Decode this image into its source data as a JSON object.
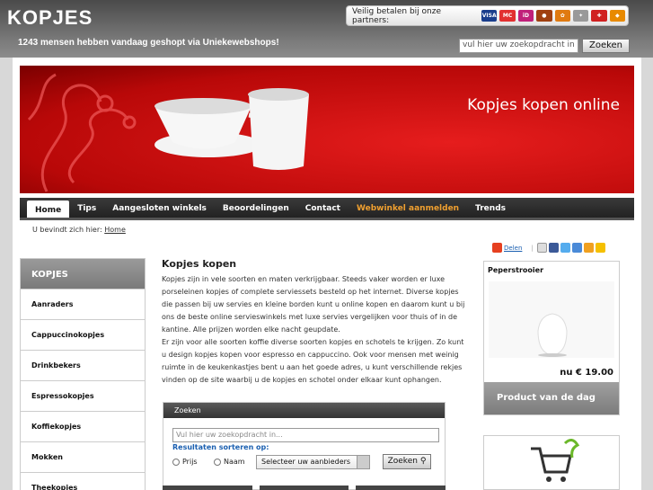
{
  "header": {
    "logo": "KOPJES",
    "tagline": "1243 mensen hebben vandaag geshopt via Uniekewebshops!",
    "partners_label": "Veilig betalen bij onze partners:",
    "partner_icons": [
      "visa-icon",
      "mastercard-icon",
      "ideal-icon",
      "paypal-icon",
      "giropay-icon",
      "ups-icon",
      "dhl-icon",
      "bank-icon"
    ],
    "search_placeholder": "vul hier uw zoekopdracht in",
    "search_button": "Zoeken"
  },
  "banner": {
    "title": "Kopjes kopen online"
  },
  "nav": {
    "items": [
      {
        "label": "Home"
      },
      {
        "label": "Tips"
      },
      {
        "label": "Aangesloten winkels"
      },
      {
        "label": "Beoordelingen"
      },
      {
        "label": "Contact"
      },
      {
        "label": "Webwinkel aanmelden"
      },
      {
        "label": "Trends"
      }
    ]
  },
  "breadcrumb": {
    "prefix": "U bevindt zich hier:",
    "link": "Home"
  },
  "sidebar": {
    "title": "KOPJES",
    "items": [
      {
        "label": "Aanraders"
      },
      {
        "label": "Cappuccinokopjes"
      },
      {
        "label": "Drinkbekers"
      },
      {
        "label": "Espressokopjes"
      },
      {
        "label": "Koffiekopjes"
      },
      {
        "label": "Mokken"
      },
      {
        "label": "Theekopjes"
      }
    ]
  },
  "main": {
    "title": "Kopjes kopen",
    "paragraph1": "Kopjes zijn in vele soorten en maten verkrijgbaar. Steeds vaker worden er luxe porseleinen kopjes of complete serviessets besteld op het internet. Diverse kopjes die passen bij uw servies en kleine borden kunt u online kopen en daarom kunt u bij ons de beste online servieswinkels met luxe servies vergelijken voor thuis of in de kantine. Alle prijzen worden elke nacht geupdate.",
    "paragraph2": "Er zijn voor alle soorten koffie diverse soorten kopjes en schotels te krijgen. Zo kunt u design kopjes kopen voor espresso en cappuccino. Ook voor mensen met weinig ruimte in de keukenkastjes bent u aan het goede adres, u kunt verschillende rekjes vinden op de site waarbij u de kopjes en schotel onder elkaar kunt ophangen."
  },
  "search": {
    "bar_title": "Zoeken",
    "placeholder": "Vul hier uw zoekopdracht in...",
    "sort_label": "Resultaten sorteren op:",
    "radio_price": "Prijs",
    "radio_name": "Naam",
    "select_value": "Selecteer uw aanbieders",
    "button": "Zoeken"
  },
  "share": {
    "label": "Delen"
  },
  "product": {
    "title": "Peperstrooier",
    "price": "nu € 19.00",
    "footer": "Product van de dag"
  },
  "colors": {
    "accent": "#cc1010",
    "nav_dark": "#2a2a2a",
    "link": "#1a5fb0",
    "orange": "#f0a030"
  }
}
